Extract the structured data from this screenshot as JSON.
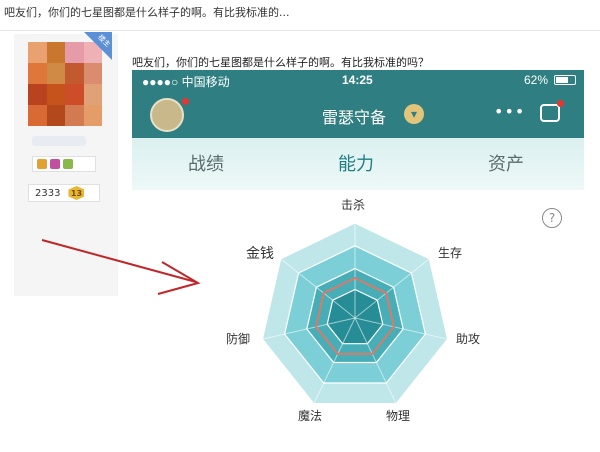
{
  "thread": {
    "title": "吧友们，你们的七星图都是什么样子的啊。有比我标准的...",
    "host_badge": "楼主"
  },
  "user": {
    "score": "2333",
    "level": "13"
  },
  "post": {
    "text": "吧友们，你们的七星图都是什么样子的啊。有比我标准的吗？"
  },
  "phone": {
    "status_bar": {
      "carrier": "●●●●○ 中国移动",
      "time": "14:25",
      "battery": "62%"
    },
    "nav": {
      "title": "雷瑟守备",
      "more": "•••"
    },
    "tabs": [
      {
        "label": "战绩",
        "active": false
      },
      {
        "label": "能力",
        "active": true
      },
      {
        "label": "资产",
        "active": false
      }
    ]
  },
  "radar": {
    "axes": [
      "击杀",
      "生存",
      "助攻",
      "物理",
      "魔法",
      "防御",
      "金钱"
    ],
    "help": "?"
  },
  "colors": {
    "teal": "#2f7f82",
    "radar_outer": "#bfe6e9",
    "radar_mid": "#7ccfd6",
    "radar_inner": "#47aeb7",
    "radar_core": "#268d96",
    "score_line": "#d77b6a",
    "arrow": "#c0262a"
  },
  "icons": [
    "wifi-icon",
    "battery-icon",
    "chevron-down-icon",
    "more-icon",
    "robot-icon",
    "help-icon",
    "arrow-icon"
  ]
}
